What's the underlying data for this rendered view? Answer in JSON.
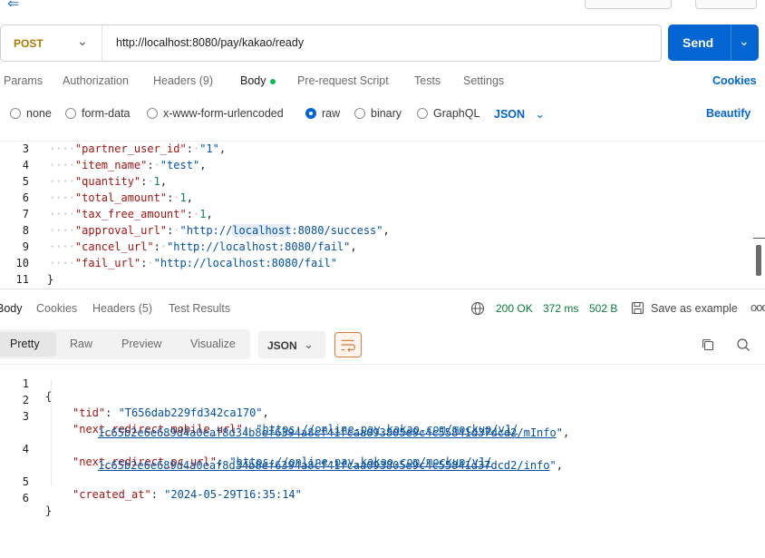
{
  "request": {
    "method": "POST",
    "url": "http://localhost:8080/pay/kakao/ready",
    "send_label": "Send"
  },
  "request_tabs": {
    "params": "Params",
    "authorization": "Authorization",
    "headers": "Headers (9)",
    "body": "Body",
    "prerequest": "Pre-request Script",
    "tests": "Tests",
    "settings": "Settings",
    "cookies": "Cookies"
  },
  "body_types": {
    "none": "none",
    "form_data": "form-data",
    "urlencoded": "x-www-form-urlencoded",
    "raw": "raw",
    "binary": "binary",
    "graphql": "GraphQL",
    "format": "JSON",
    "beautify": "Beautify",
    "selected": "raw"
  },
  "request_body": {
    "lines": [
      {
        "num": "3",
        "key": "\"partner_user_id\"",
        "value": "\"1\"",
        "vtype": "string",
        "comma": ","
      },
      {
        "num": "4",
        "key": "\"item_name\"",
        "value": "\"test\"",
        "vtype": "string",
        "comma": ","
      },
      {
        "num": "5",
        "key": "\"quantity\"",
        "value": "1",
        "vtype": "number",
        "comma": ","
      },
      {
        "num": "6",
        "key": "\"total_amount\"",
        "value": "1",
        "vtype": "number",
        "comma": ","
      },
      {
        "num": "7",
        "key": "\"tax_free_amount\"",
        "value": "1",
        "vtype": "number",
        "comma": ","
      },
      {
        "num": "8",
        "key": "\"approval_url\"",
        "value": "\"http://localhost:8080/success\"",
        "vtype": "string",
        "comma": ","
      },
      {
        "num": "9",
        "key": "\"cancel_url\"",
        "value": "\"http://localhost:8080/fail\"",
        "vtype": "string",
        "comma": ","
      },
      {
        "num": "10",
        "key": "\"fail_url\"",
        "value": "\"http://localhost:8080/fail\"",
        "vtype": "string",
        "comma": ""
      },
      {
        "num": "11",
        "brace": "}"
      }
    ]
  },
  "response_tabs": {
    "body": "Body",
    "cookies": "Cookies",
    "headers": "Headers (5)",
    "test_results": "Test Results",
    "status": "200 OK",
    "time": "372 ms",
    "size": "502 B",
    "save_example": "Save as example",
    "more": "ooo"
  },
  "response_view": {
    "pretty": "Pretty",
    "raw": "Raw",
    "preview": "Preview",
    "visualize": "Visualize",
    "format": "JSON"
  },
  "response_body": {
    "line1": {
      "num": "1",
      "text": "{"
    },
    "line2": {
      "num": "2",
      "key": "\"tid\"",
      "value": "\"T656dab229fd342ca170\""
    },
    "line3": {
      "num": "3",
      "key": "\"next_redirect_mobile_url\"",
      "url_a": "https://online-pay.kakao.com/mockup/v1/",
      "url_b": "1c65b2e6e689d4a0eaf8d34b8ef6394a8cf41fcaa093805e9c4c55841d37dcd2/mInfo"
    },
    "line4": {
      "num": "4",
      "key": "\"next_redirect_pc_url\"",
      "url_a": "https://online-pay.kakao.com/mockup/v1/",
      "url_b": "1c65b2e6e689d4a0eaf8d34b8ef6394a8cf41fcaa093805e9c4c55841d37dcd2/info"
    },
    "line5": {
      "num": "5",
      "key": "\"created_at\"",
      "value": "\"2024-05-29T16:35:14\""
    },
    "line6": {
      "num": "6",
      "text": "}"
    }
  },
  "colors": {
    "accent": "#0265d2",
    "method": "#ad7a03",
    "status": "#0a7b3e",
    "body_dot": "#0cbb52"
  }
}
